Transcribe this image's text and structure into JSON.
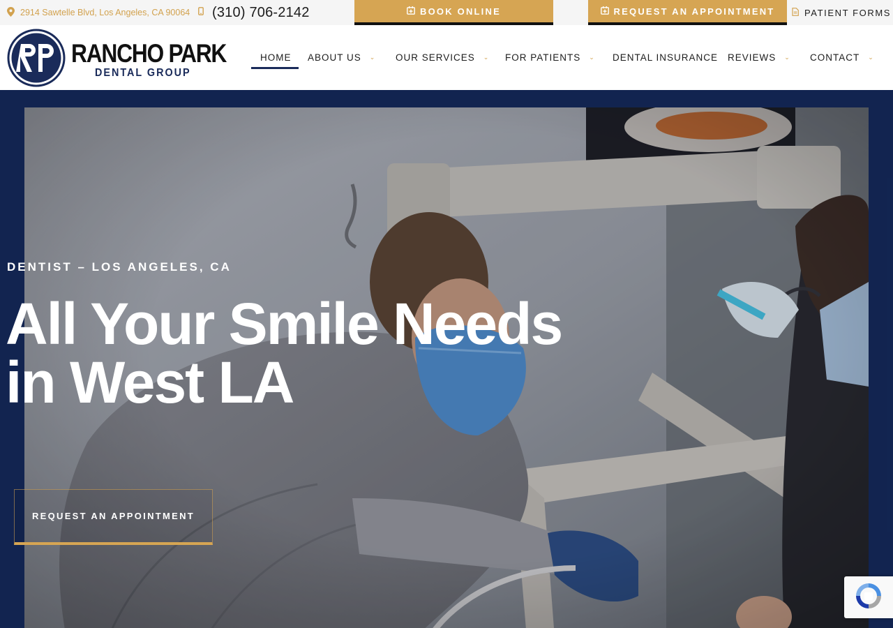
{
  "topbar": {
    "address": "2914 Sawtelle Blvd, Los Angeles, CA 90064",
    "phone": "(310) 706-2142",
    "book_online": "BOOK ONLINE",
    "request_appointment": "REQUEST AN APPOINTMENT",
    "patient_forms": "PATIENT FORMS"
  },
  "logo": {
    "line1": "RANCHO PARK",
    "line2": "DENTAL GROUP",
    "monogram": "RP"
  },
  "nav": {
    "items": [
      {
        "label": "HOME",
        "has_dropdown": false,
        "active": true
      },
      {
        "label": "ABOUT US",
        "has_dropdown": true
      },
      {
        "label": "OUR SERVICES",
        "has_dropdown": true
      },
      {
        "label": "FOR PATIENTS",
        "has_dropdown": true
      },
      {
        "label": "DENTAL INSURANCE",
        "has_dropdown": false
      },
      {
        "label": "REVIEWS",
        "has_dropdown": true
      },
      {
        "label": "CONTACT",
        "has_dropdown": true
      }
    ]
  },
  "hero": {
    "kicker": "DENTIST – LOS ANGELES, CA",
    "headline_line1": "All Your Smile Needs",
    "headline_line2": "in West LA",
    "cta": "REQUEST AN APPOINTMENT"
  },
  "colors": {
    "gold": "#d6a553",
    "navy": "#12285a",
    "text_dark": "#1c1c1c"
  },
  "icons": [
    "map-pin-icon",
    "mobile-phone-icon",
    "calendar-plus-icon",
    "document-icon",
    "chevron-down-icon",
    "recaptcha-icon"
  ]
}
